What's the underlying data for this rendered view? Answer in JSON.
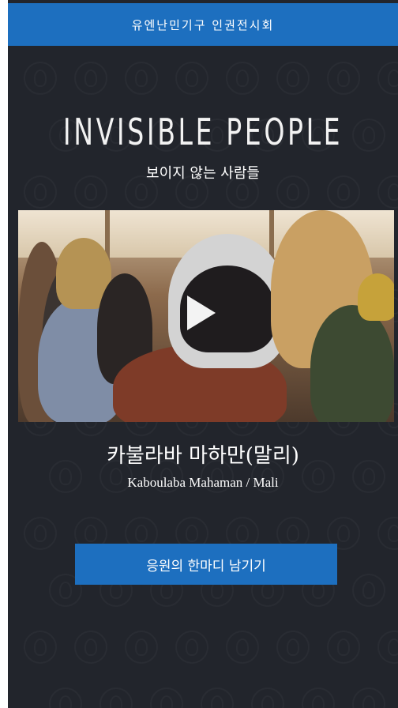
{
  "header": {
    "title": "유엔난민기구  인권전시회"
  },
  "hero": {
    "title": "INVISIBLE PEOPLE",
    "subtitle": "보이지 않는 사람들"
  },
  "video": {
    "play_icon": "play-icon"
  },
  "person": {
    "name_ko": "카불라바 마하만(말리)",
    "name_en": "Kaboulaba Mahaman / Mali"
  },
  "cta": {
    "label": "응원의 한마디 남기기"
  },
  "colors": {
    "accent": "#1d6fbf",
    "background": "#22252c"
  }
}
